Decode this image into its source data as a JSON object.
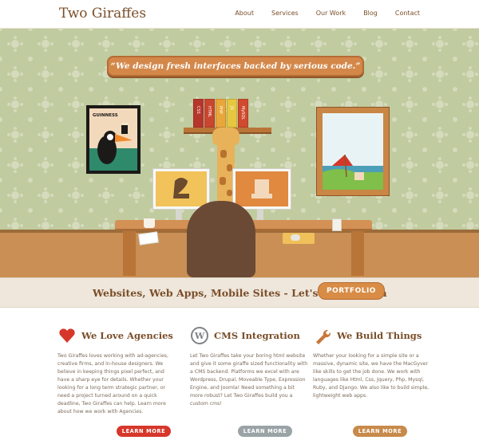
{
  "header": {
    "logo": "Two Giraffes",
    "nav": [
      "About",
      "Services",
      "Our Work",
      "Blog",
      "Contact"
    ]
  },
  "hero": {
    "banner": "“We design fresh interfaces backed by serious code.”",
    "poster_title": "GUINNESS",
    "books": [
      "CSS",
      "HTML",
      "PHP",
      "JS",
      "MySQL"
    ]
  },
  "cta": {
    "text": "Websites, Web Apps, Mobile Sites - Let's Build Them",
    "button": "PORTFOLIO"
  },
  "columns": [
    {
      "title": "We Love Agencies",
      "icon": "heart-icon",
      "body": "Two Giraffes loves working with ad-agencies, creative firms, and in-house designers. We believe in keeping things pixel perfect, and have a sharp eye for details. Whether your looking for a long term strategic partner, or need a project turned around on a quick deadline, Two Giraffes can help. Learn more about how we work with Agencies.",
      "button": "LEARN MORE",
      "color": "#d7372b"
    },
    {
      "title": "CMS Integration",
      "icon": "wordpress-icon",
      "body": "Let Two Giraffes take your boring html website and give it some giraffe sized functionality with a CMS backend. Platforms we excel with are Wordpress, Drupal, Moveable Type, Expression Engine, and Joomla! Need something a bit more robust? Let Two Giraffes build you a custom cms!",
      "button": "LEARN MORE",
      "color": "#9aa3a6"
    },
    {
      "title": "We Build Things",
      "icon": "wrench-icon",
      "body": "Whether your looking for a simple site or a massive, dynamic site, we have the MacGyver like skills to get the job done. We work with languages like Html, Css, Jquery, Php, Mysql, Ruby, and Django. We also like to build simple, lightweight web apps.",
      "button": "LEARN MORE",
      "color": "#c88a4b"
    }
  ]
}
